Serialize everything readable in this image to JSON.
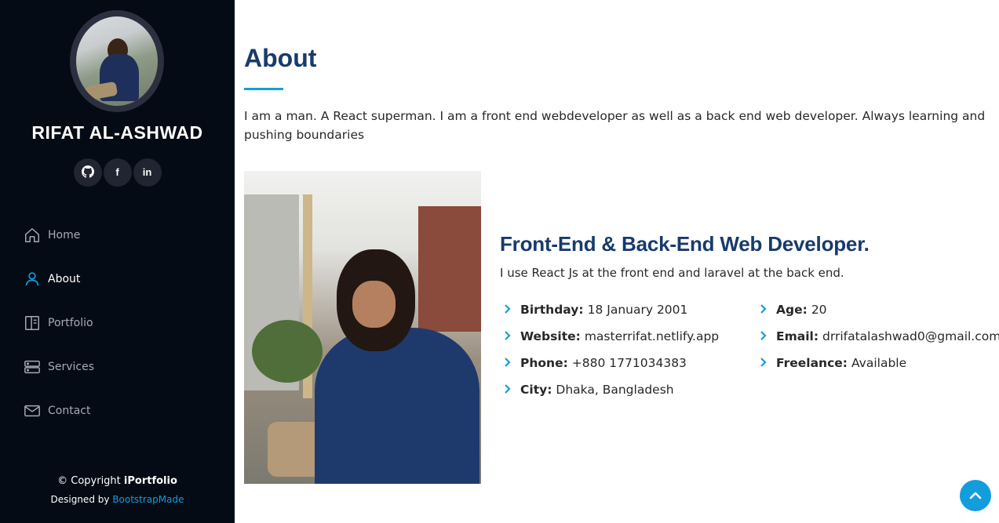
{
  "sidebar": {
    "name": "RIFAT AL-ASHWAD",
    "social": [
      {
        "icon": "github-icon",
        "label": ""
      },
      {
        "icon": "facebook-icon",
        "label": "f"
      },
      {
        "icon": "linkedin-icon",
        "label": "in"
      }
    ],
    "nav": [
      {
        "label": "Home",
        "icon": "home-icon",
        "active": false
      },
      {
        "label": "About",
        "icon": "person-icon",
        "active": true
      },
      {
        "label": "Portfolio",
        "icon": "portfolio-icon",
        "active": false
      },
      {
        "label": "Services",
        "icon": "server-icon",
        "active": false
      },
      {
        "label": "Contact",
        "icon": "envelope-icon",
        "active": false
      }
    ],
    "footer": {
      "copyright_prefix": "© Copyright",
      "copyright_brand": "iPortfolio",
      "designed_prefix": "Designed by",
      "designed_link": "BootstrapMade"
    }
  },
  "about": {
    "title": "About",
    "intro": "I am a man. A React superman. I am a front end webdeveloper as well as a back end web developer. Always learning and pushing boundaries",
    "role": "Front-End & Back-End Web Developer.",
    "role_desc": "I use React Js at the front end and laravel at the back end.",
    "info_left": [
      {
        "label": "Birthday:",
        "value": "18 January 2001"
      },
      {
        "label": "Website:",
        "value": "masterrifat.netlify.app"
      },
      {
        "label": "Phone:",
        "value": "+880 1771034383"
      },
      {
        "label": "City:",
        "value": "Dhaka, Bangladesh"
      }
    ],
    "info_right": [
      {
        "label": "Age:",
        "value": "20"
      },
      {
        "label": "Email:",
        "value": "drrifatalashwad0@gmail.com"
      },
      {
        "label": "Freelance:",
        "value": "Available"
      }
    ]
  },
  "colors": {
    "sidebar_bg": "#040b14",
    "accent": "#149ddd",
    "heading": "#173b6c",
    "nav_inactive": "#a8a9b4"
  }
}
